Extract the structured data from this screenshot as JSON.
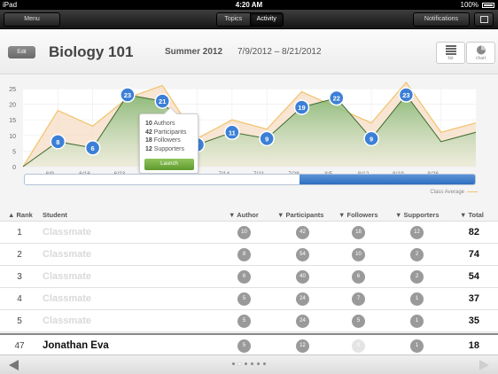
{
  "status_bar": {
    "carrier": "iPad",
    "time": "4:20 AM",
    "battery": "100%"
  },
  "nav": {
    "menu_label": "Menu",
    "tabs": [
      "Topics",
      "Activity"
    ],
    "active_tab": "Activity",
    "notifications_label": "Notifications"
  },
  "header": {
    "edit_label": "Edit",
    "course": "Biology 101",
    "term": "Summer 2012",
    "date_range": "7/9/2012 – 8/21/2012",
    "list_label": "list",
    "chart_label": "chart"
  },
  "chart_data": {
    "type": "area",
    "y_ticks": [
      0,
      5,
      10,
      15,
      20,
      25
    ],
    "ylim": [
      0,
      25
    ],
    "x_labels": [
      "6/9",
      "6/16",
      "6/23",
      "6/30",
      "7/7",
      "7/14",
      "7/21",
      "7/28",
      "8/5",
      "8/12",
      "8/19",
      "8/26"
    ],
    "student_series": [
      0,
      8,
      6,
      23,
      21,
      7,
      11,
      9,
      19,
      22,
      9,
      23,
      8,
      11
    ],
    "labeled_points": [
      8,
      6,
      23,
      21,
      7,
      11,
      9,
      19,
      22,
      9,
      23
    ],
    "class_average": [
      0,
      18,
      13,
      22,
      26,
      9,
      15,
      12,
      24,
      19,
      14,
      27,
      11,
      14
    ],
    "legend": "Class Average",
    "colors": {
      "student_fill": "#7bb26a",
      "average_line": "#f2c36a",
      "point": "#3c7fd6"
    }
  },
  "tooltip": {
    "lines": [
      {
        "value": "10",
        "label": "Authors"
      },
      {
        "value": "42",
        "label": "Participants"
      },
      {
        "value": "18",
        "label": "Followers"
      },
      {
        "value": "12",
        "label": "Supporters"
      }
    ],
    "launch_label": "Launch"
  },
  "scroll_position": 0.61,
  "table": {
    "headers": {
      "rank": "Rank",
      "student": "Student",
      "author": "Author",
      "participants": "Participants",
      "followers": "Followers",
      "supporters": "Supporters",
      "total": "Total"
    },
    "rows": [
      {
        "rank": "1",
        "student": "Classmate",
        "author": "10",
        "participants": "42",
        "followers": "18",
        "supporters": "12",
        "total": "82"
      },
      {
        "rank": "2",
        "student": "Classmate",
        "author": "8",
        "participants": "54",
        "followers": "10",
        "supporters": "2",
        "total": "74"
      },
      {
        "rank": "3",
        "student": "Classmate",
        "author": "6",
        "participants": "40",
        "followers": "6",
        "supporters": "2",
        "total": "54"
      },
      {
        "rank": "4",
        "student": "Classmate",
        "author": "5",
        "participants": "24",
        "followers": "7",
        "supporters": "1",
        "total": "37"
      },
      {
        "rank": "5",
        "student": "Classmate",
        "author": "5",
        "participants": "24",
        "followers": "5",
        "supporters": "1",
        "total": "35"
      }
    ],
    "me": {
      "rank": "47",
      "student": "Jonathan Eva",
      "author": "5",
      "participants": "12",
      "followers": "0",
      "supporters": "1",
      "total": "18"
    }
  },
  "pager": {
    "pages": 6,
    "current": 1
  }
}
